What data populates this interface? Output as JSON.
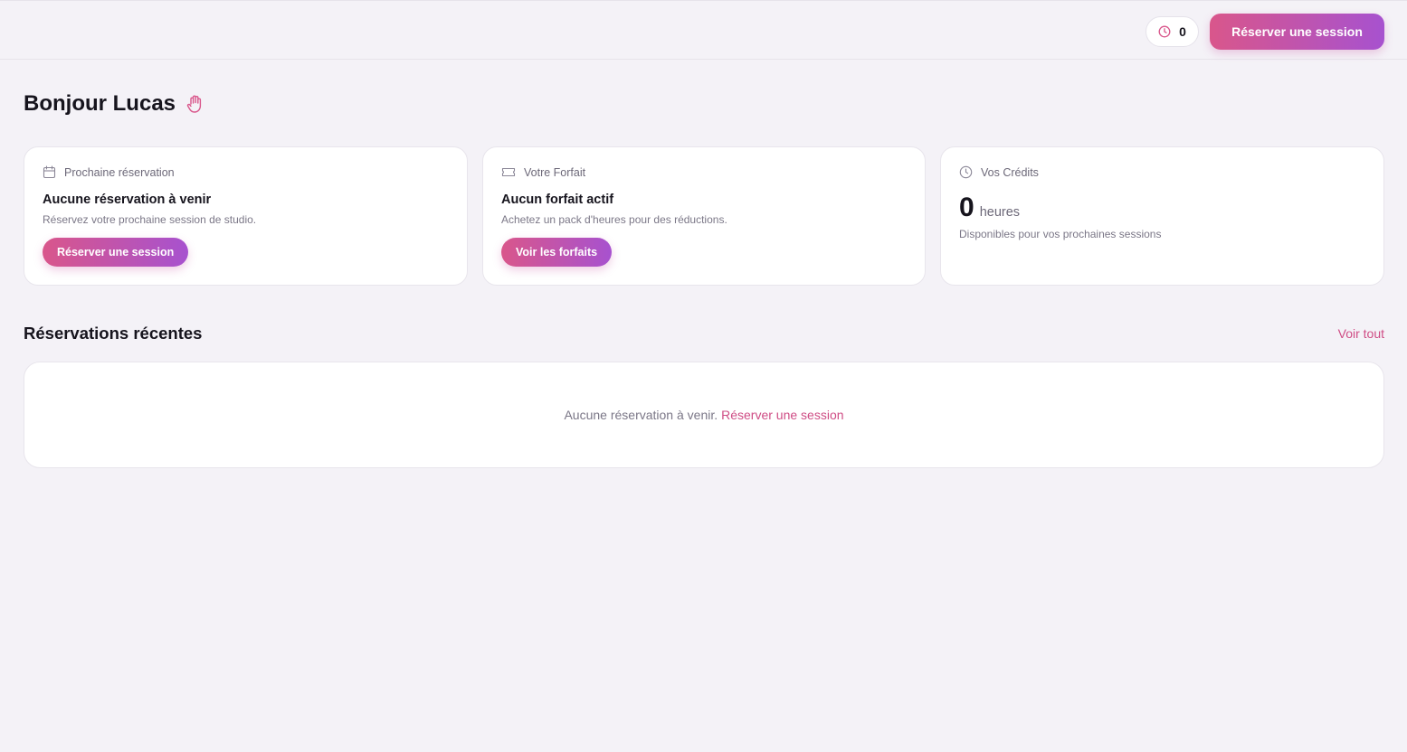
{
  "header": {
    "credits_value": "0",
    "reserve_button": "Réserver une session"
  },
  "greeting": {
    "text": "Bonjour Lucas",
    "icon": "hand-wave-icon"
  },
  "cards": {
    "next_booking": {
      "label": "Prochaine réservation",
      "title": "Aucune réservation à venir",
      "subtitle": "Réservez votre prochaine session de studio.",
      "button": "Réserver une session",
      "icon": "calendar-icon"
    },
    "plan": {
      "label": "Votre Forfait",
      "title": "Aucun forfait actif",
      "subtitle": "Achetez un pack d'heures pour des réductions.",
      "button": "Voir les forfaits",
      "icon": "ticket-icon"
    },
    "credits": {
      "label": "Vos Crédits",
      "value": "0",
      "unit": "heures",
      "subtitle": "Disponibles pour vos prochaines sessions",
      "icon": "clock-icon"
    }
  },
  "recent": {
    "title": "Réservations récentes",
    "see_all": "Voir tout",
    "empty_text": "Aucune réservation à venir.",
    "empty_link": "Réserver une session"
  },
  "colors": {
    "accent_start": "#d9568b",
    "accent_end": "#a752cf",
    "link": "#cf4d85",
    "background": "#f4f2f7"
  }
}
